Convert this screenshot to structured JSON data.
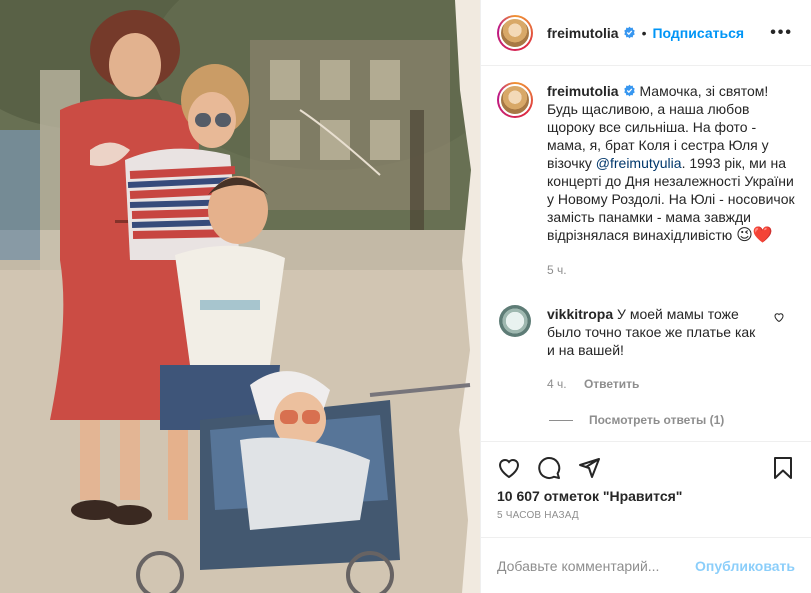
{
  "header": {
    "username": "freimutolia",
    "separator": "•",
    "follow_label": "Подписаться",
    "more_label": "•••"
  },
  "caption": {
    "username": "freimutolia",
    "text_before": " Мамочка, зі святом! Будь щасливою, а наша любов щороку все сильніша. На фото - мама, я, брат Коля і сестра Юля у візочку ",
    "mention": "@freimutyulia",
    "text_after": ". 1993 рік, ми на концерті до Дня незалежності України у Новому Роздолі. На Юлі - носовичок замість панамки - мама завжди відрізнялася винахідливістю ",
    "emojis": "😉❤️",
    "age": "5 ч."
  },
  "comment": {
    "username": "vikkitropa",
    "text": "У моей мамы тоже было точно такое же платье как и на вашей!",
    "age": "4 ч.",
    "reply_label": "Ответить",
    "view_replies": "Посмотреть ответы (1)"
  },
  "actions": {
    "icons": [
      "heart-icon",
      "comment-icon",
      "share-icon",
      "bookmark-icon"
    ],
    "likes": "10 607 отметок \"Нравится\"",
    "timestamp": "5 часов назад"
  },
  "add_comment": {
    "placeholder": "Добавьте комментарий...",
    "publish_label": "Опубликовать"
  },
  "colors": {
    "link_blue": "#0095f6",
    "mention_blue": "#00376b",
    "muted_gray": "#8e8e8e",
    "text": "#262626"
  }
}
